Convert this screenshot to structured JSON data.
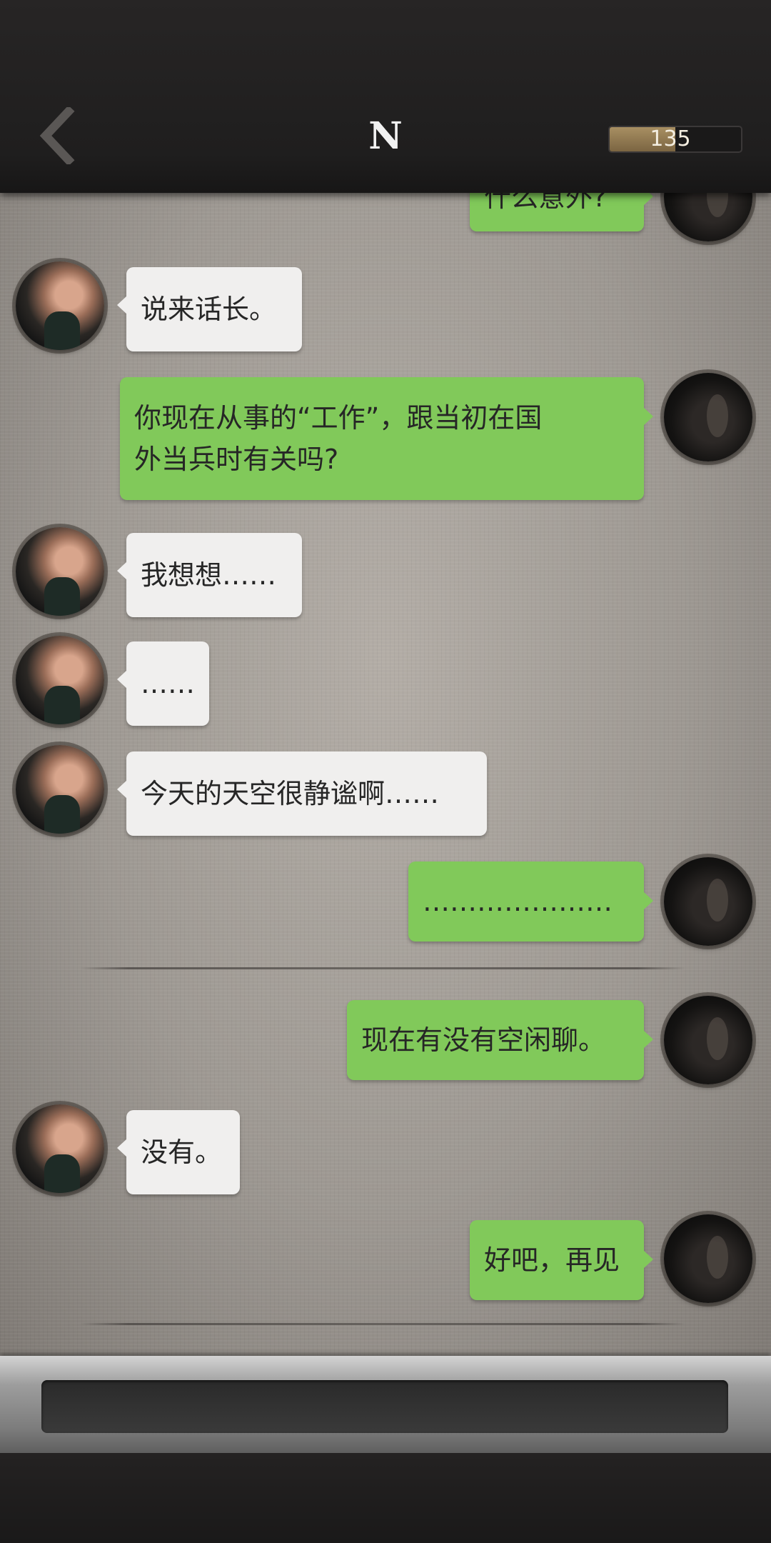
{
  "header": {
    "back_icon": "chevron-left-icon",
    "title": "N",
    "energy": {
      "value": "135",
      "fill_fraction": 0.5
    }
  },
  "messages": [
    {
      "from": "me",
      "text": "什么意外?"
    },
    {
      "from": "npc",
      "text": "说来话长。"
    },
    {
      "from": "me",
      "line1": "你现在从事的“工作”，跟当初在国",
      "line2": "外当兵时有关吗?"
    },
    {
      "from": "npc",
      "text": "我想想……"
    },
    {
      "from": "npc",
      "text": "……"
    },
    {
      "from": "npc",
      "text": "今天的天空很静谧啊……"
    },
    {
      "from": "me",
      "text": "…………………"
    },
    {
      "from": "me",
      "text": "现在有没有空闲聊。"
    },
    {
      "from": "npc",
      "text": "没有。"
    },
    {
      "from": "me",
      "text": "好吧，再见"
    }
  ],
  "input": {
    "placeholder": ""
  },
  "colors": {
    "me_bubble": "#81c95a",
    "npc_bubble": "#f0efee"
  }
}
